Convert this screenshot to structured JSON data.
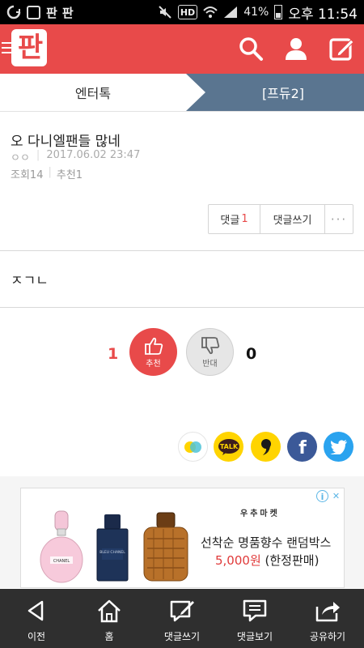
{
  "status_bar": {
    "battery": "41%",
    "time": "오후 11:54",
    "app_icons": [
      "판",
      "판"
    ],
    "hd_label": "HD"
  },
  "header": {
    "logo": "판"
  },
  "tabs": {
    "left": "엔터톡",
    "right": "[프듀2]"
  },
  "post": {
    "title": "오 다니엘팬들 많네",
    "author": "ㅇㅇ",
    "date": "2017.06.02 23:47",
    "views": "조회14",
    "recommends": "추천1",
    "body": "ㅈㄱㄴ"
  },
  "comment_bar": {
    "comment_label": "댓글",
    "comment_count": "1",
    "write_label": "댓글쓰기",
    "more_label": "···"
  },
  "votes": {
    "up_count": "1",
    "up_label": "추천",
    "down_label": "반대",
    "down_count": "0"
  },
  "share": {
    "talk_label": "TALK",
    "comma_label": "❜",
    "facebook_label": "f"
  },
  "ad": {
    "store": "우추마켓",
    "line1": "선착순 명품향수 랜덤박스",
    "price": "5,000원",
    "suffix": "(한정판매)",
    "bottle1_label": "CHANEL",
    "bottle2_label": "BLEU CHANEL",
    "info_label": "i",
    "close_label": "✕"
  },
  "bottom_nav": {
    "prev": "이전",
    "home": "홈",
    "write_comment": "댓글쓰기",
    "view_comments": "댓글보기",
    "share": "공유하기"
  },
  "colors": {
    "brand_red": "#e84a4a",
    "tab_active": "#5a7590",
    "nav_bg": "#2f2f2f"
  }
}
